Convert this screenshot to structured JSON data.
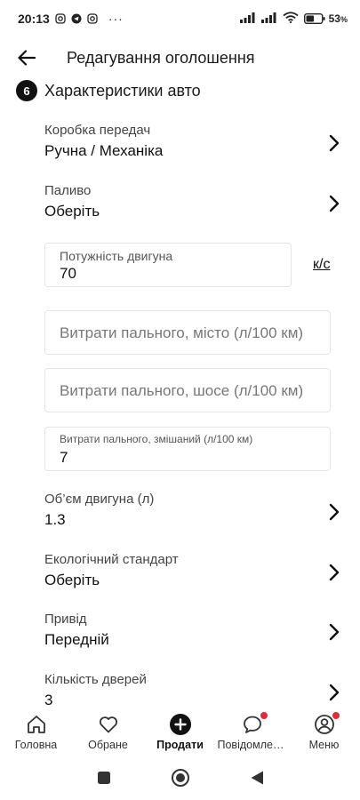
{
  "status_bar": {
    "time": "20:13",
    "battery_percent": "53",
    "battery_symbol": "%"
  },
  "header": {
    "title": "Редагування оголошення"
  },
  "section": {
    "number": "6",
    "title": "Характеристики авто"
  },
  "fields": {
    "gearbox": {
      "label": "Коробка передач",
      "value": "Ручна / Механіка"
    },
    "fuel": {
      "label": "Паливо",
      "value": "Оберіть"
    },
    "engine_power": {
      "label": "Потужність двигуна",
      "value": "70",
      "unit": "к/с"
    },
    "fuel_city": {
      "placeholder": "Витрати пального, місто (л/100 км)"
    },
    "fuel_highway": {
      "placeholder": "Витрати пального, шосе (л/100 км)"
    },
    "fuel_mixed": {
      "label": "Витрати пального, змішаний (л/100 км)",
      "value": "7"
    },
    "engine_volume": {
      "label": "Об’єм двигуна (л)",
      "value": "1.3"
    },
    "eco_standard": {
      "label": "Екологічний стандарт",
      "value": "Оберіть"
    },
    "drive": {
      "label": "Привід",
      "value": "Передній"
    },
    "doors": {
      "label": "Кількість дверей",
      "value": "3"
    }
  },
  "bottom_nav": {
    "items": [
      {
        "label": "Головна",
        "icon": "home-icon"
      },
      {
        "label": "Обране",
        "icon": "heart-icon"
      },
      {
        "label": "Продати",
        "icon": "plus-circle-icon"
      },
      {
        "label": "Повідомлення",
        "icon": "chat-bubble-icon"
      },
      {
        "label": "Меню",
        "icon": "user-icon"
      }
    ]
  },
  "colors": {
    "notification_dot": "#e02b3b",
    "text": "#1a1a1a",
    "field_border": "#e4e4e4"
  }
}
